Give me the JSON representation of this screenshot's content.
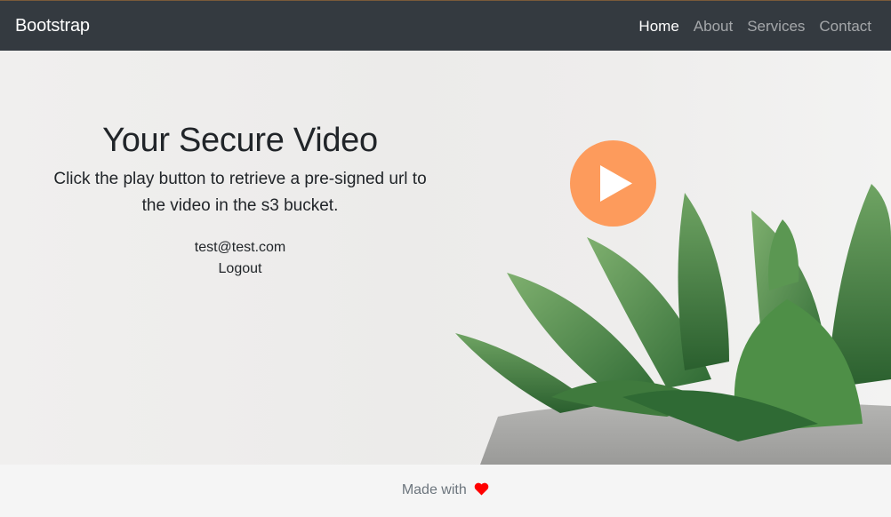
{
  "navbar": {
    "brand": "Bootstrap",
    "links": [
      {
        "label": "Home"
      },
      {
        "label": "About"
      },
      {
        "label": "Services"
      },
      {
        "label": "Contact"
      }
    ]
  },
  "hero": {
    "title": "Your Secure Video",
    "subtitle": "Click the play button to retrieve a pre-signed url to the video in the s3 bucket.",
    "email": "test@test.com",
    "logout_label": "Logout",
    "play_icon": "play-icon",
    "play_color": "#fd9b5c"
  },
  "footer": {
    "text": "Made with",
    "heart_icon": "heart-icon",
    "heart_color": "#ff0000"
  }
}
